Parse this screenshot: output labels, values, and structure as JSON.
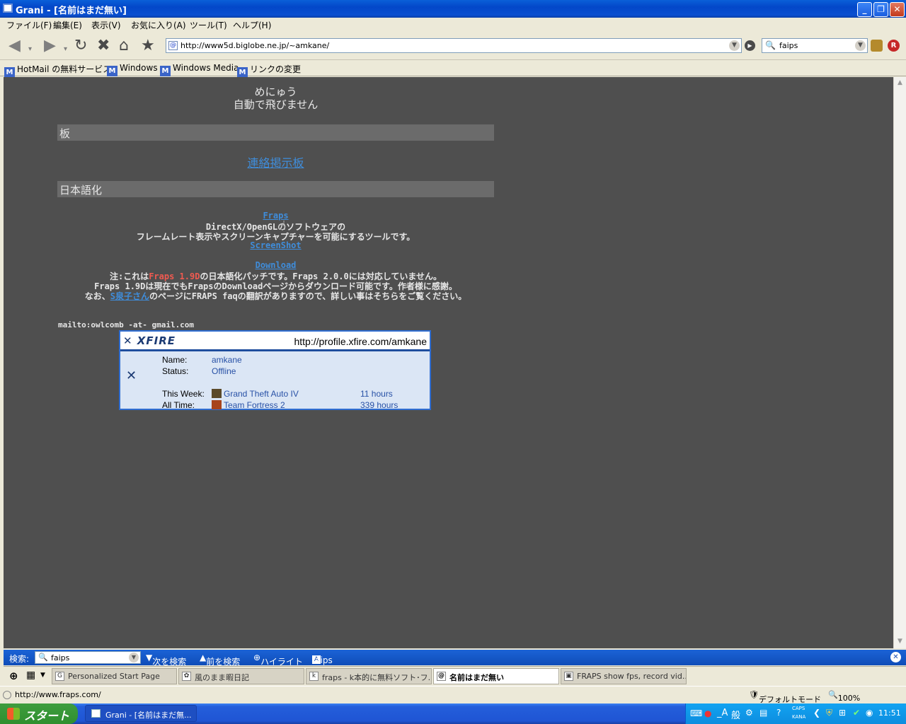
{
  "window": {
    "title": "Grani - [名前はまだ無い]"
  },
  "menu": [
    "ファイル(F)",
    "編集(E)",
    "表示(V)",
    "お気に入り(A)",
    "ツール(T)",
    "ヘルプ(H)"
  ],
  "address": {
    "url": "http://www5d.biglobe.ne.jp/~amkane/"
  },
  "search": {
    "value": "faips"
  },
  "links": [
    "HotMail の無料サービス",
    "Windows",
    "Windows Media",
    "リンクの変更"
  ],
  "page": {
    "menu_title": "めにゅう",
    "menu_note": "自動で飛びません",
    "section1": "板",
    "board_link": "連絡掲示板",
    "section2": "日本語化",
    "fraps_link": "Fraps",
    "desc1": "DirectX/OpenGLのソフトウェアの",
    "desc2": "フレームレート表示やスクリーンキャプチャーを可能にするツールです。",
    "screenshot_link": "ScreenShot",
    "download_link": "Download",
    "note1_pre": "注:これは",
    "note1_red": "Fraps 1.9D",
    "note1_post": "の日本語化パッチです。Fraps 2.0.0には対応していません。",
    "note2": "Fraps 1.9Dは現在でもFrapsのDownloadページからダウンロード可能です。作者様に感謝。",
    "note3_pre": "なお、",
    "note3_link": "S泉子さん",
    "note3_post": "のページにFRAPS faqの翻訳がありますので、詳しい事はそちらをご覧ください。",
    "mailto": "mailto:owlcomb -at- gmail.com"
  },
  "xfire": {
    "logo": "XFIRE",
    "profile_url": "http://profile.xfire.com/amkane",
    "name_label": "Name:",
    "name": "amkane",
    "status_label": "Status:",
    "status": "Offline",
    "week_label": "This Week:",
    "week_game": "Grand Theft Auto IV",
    "week_hours": "11 hours",
    "all_label": "All Time:",
    "all_game": "Team Fortress 2",
    "all_hours": "339 hours"
  },
  "findbar": {
    "label": "検索:",
    "value": "faips",
    "next": "次を検索",
    "prev": "前を検索",
    "highlight": "ハイライト",
    "match": "faips"
  },
  "tabs": [
    {
      "label": "Personalized Start Page"
    },
    {
      "label": "風のまま暇日記"
    },
    {
      "label": "fraps - k本的に無料ソフト･フ..."
    },
    {
      "label": "名前はまだ無い"
    },
    {
      "label": "FRAPS show fps, record vid..."
    }
  ],
  "status": {
    "url": "http://www.fraps.com/",
    "mode": "デフォルトモード",
    "zoom": "100%"
  },
  "taskbar": {
    "start": "スタート",
    "task": "Grani - [名前はまだ無...",
    "ime": "般",
    "caps": "CAPS",
    "kana": "KANA",
    "clock": "11:51"
  }
}
